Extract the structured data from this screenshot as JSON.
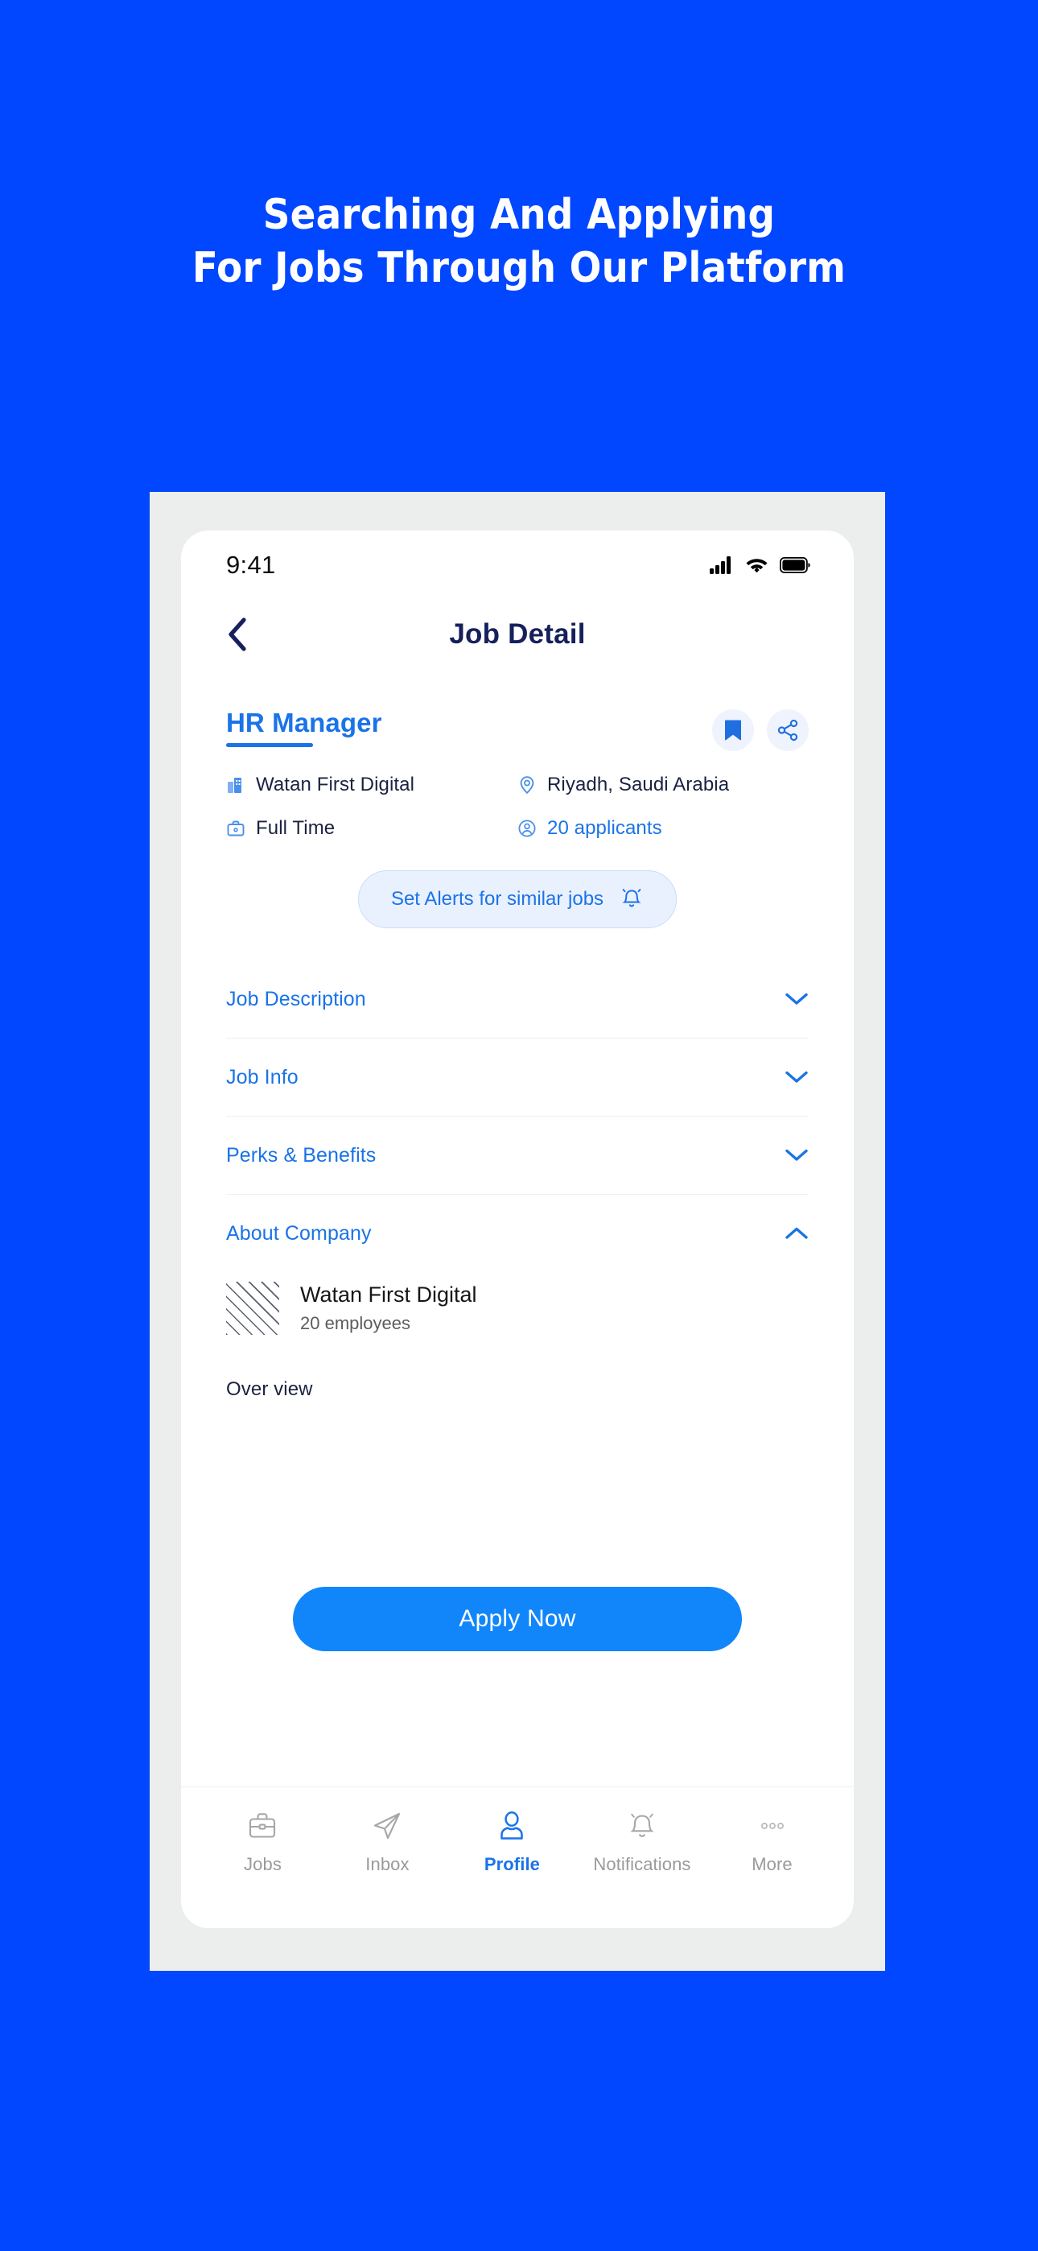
{
  "promo": {
    "line1": "Searching And Applying",
    "line2": "For Jobs Through Our Platform",
    "background_color": "#0047ff",
    "text_color": "#ffffff"
  },
  "statusbar": {
    "time": "9:41",
    "icons": [
      "cellular-signal-icon",
      "wifi-icon",
      "battery-icon"
    ]
  },
  "navbar": {
    "back_icon": "chevron-left-icon",
    "title": "Job Detail"
  },
  "job": {
    "title": "HR Manager",
    "bookmark_icon": "bookmark-icon",
    "share_icon": "share-icon",
    "meta": [
      {
        "icon": "building-icon",
        "text": "Watan First Digital",
        "accent": false
      },
      {
        "icon": "location-pin-icon",
        "text": "Riyadh, Saudi Arabia",
        "accent": false
      },
      {
        "icon": "briefcase-icon",
        "text": "Full Time",
        "accent": false
      },
      {
        "icon": "applicants-icon",
        "text": "20 applicants",
        "accent": true
      }
    ]
  },
  "alerts": {
    "label": "Set Alerts for similar jobs",
    "icon": "bell-icon"
  },
  "accordions": [
    {
      "label": "Job Description",
      "expanded": false,
      "chevron": "chevron-down-icon"
    },
    {
      "label": "Job Info",
      "expanded": false,
      "chevron": "chevron-down-icon"
    },
    {
      "label": "Perks & Benefits",
      "expanded": false,
      "chevron": "chevron-down-icon"
    },
    {
      "label": "About Company",
      "expanded": true,
      "chevron": "chevron-up-icon"
    }
  ],
  "company": {
    "logo": "company-logo-placeholder",
    "name": "Watan First Digital",
    "size": "20 employees",
    "overview_label": "Over view"
  },
  "apply": {
    "label": "Apply Now",
    "color": "#1186fb"
  },
  "tabbar": {
    "items": [
      {
        "label": "Jobs",
        "icon": "briefcase-icon",
        "active": false
      },
      {
        "label": "Inbox",
        "icon": "paper-plane-icon",
        "active": false
      },
      {
        "label": "Profile",
        "icon": "person-icon",
        "active": true
      },
      {
        "label": "Notifications",
        "icon": "bell-icon",
        "active": false
      },
      {
        "label": "More",
        "icon": "ellipsis-icon",
        "active": false
      }
    ]
  },
  "colors": {
    "brand_blue": "#0047ff",
    "accent_blue": "#1a73e8",
    "navy": "#16205a",
    "frame_gray": "#eceded"
  }
}
